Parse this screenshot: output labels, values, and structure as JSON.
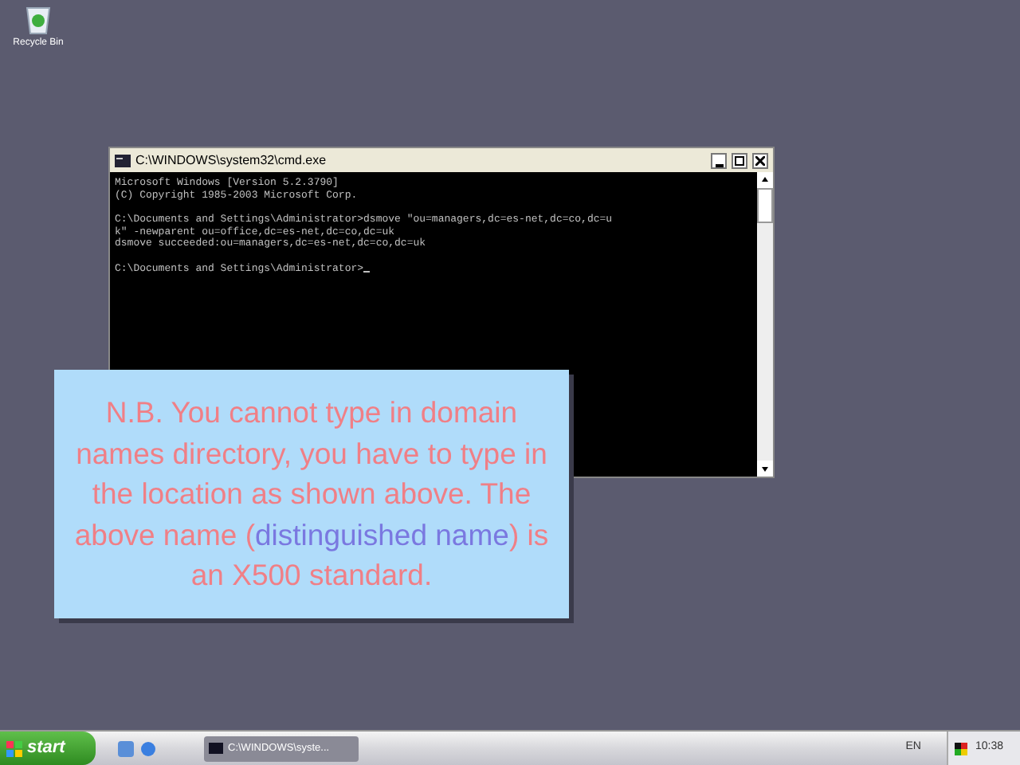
{
  "desktop_icons": [
    {
      "label": "Recycle Bin"
    }
  ],
  "window": {
    "title": "C:\\WINDOWS\\system32\\cmd.exe",
    "console_blocks": [
      [
        "Microsoft Windows [Version 5.2.3790]",
        "(C) Copyright 1985-2003 Microsoft Corp."
      ],
      [
        "C:\\Documents and Settings\\Administrator>dsmove \"ou=managers,dc=es-net,dc=co,dc=u",
        "k\" -newparent ou=office,dc=es-net,dc=co,dc=uk",
        "dsmove succeeded:ou=managers,dc=es-net,dc=co,dc=uk"
      ],
      [
        "C:\\Documents and Settings\\Administrator>"
      ]
    ]
  },
  "callout": {
    "segments": [
      {
        "kind": "plain",
        "text": "N.B. You cannot type in domain names directory, you have to type in the location as shown above. The above name ("
      },
      {
        "kind": "term",
        "text": "distinguished name"
      },
      {
        "kind": "plain",
        "text": ") is an X500 standard."
      }
    ]
  },
  "taskbar": {
    "start": "start",
    "tasks": [
      {
        "label": "C:\\WINDOWS\\syste...",
        "selected": false
      }
    ],
    "language": "EN",
    "clock": "10:38"
  }
}
